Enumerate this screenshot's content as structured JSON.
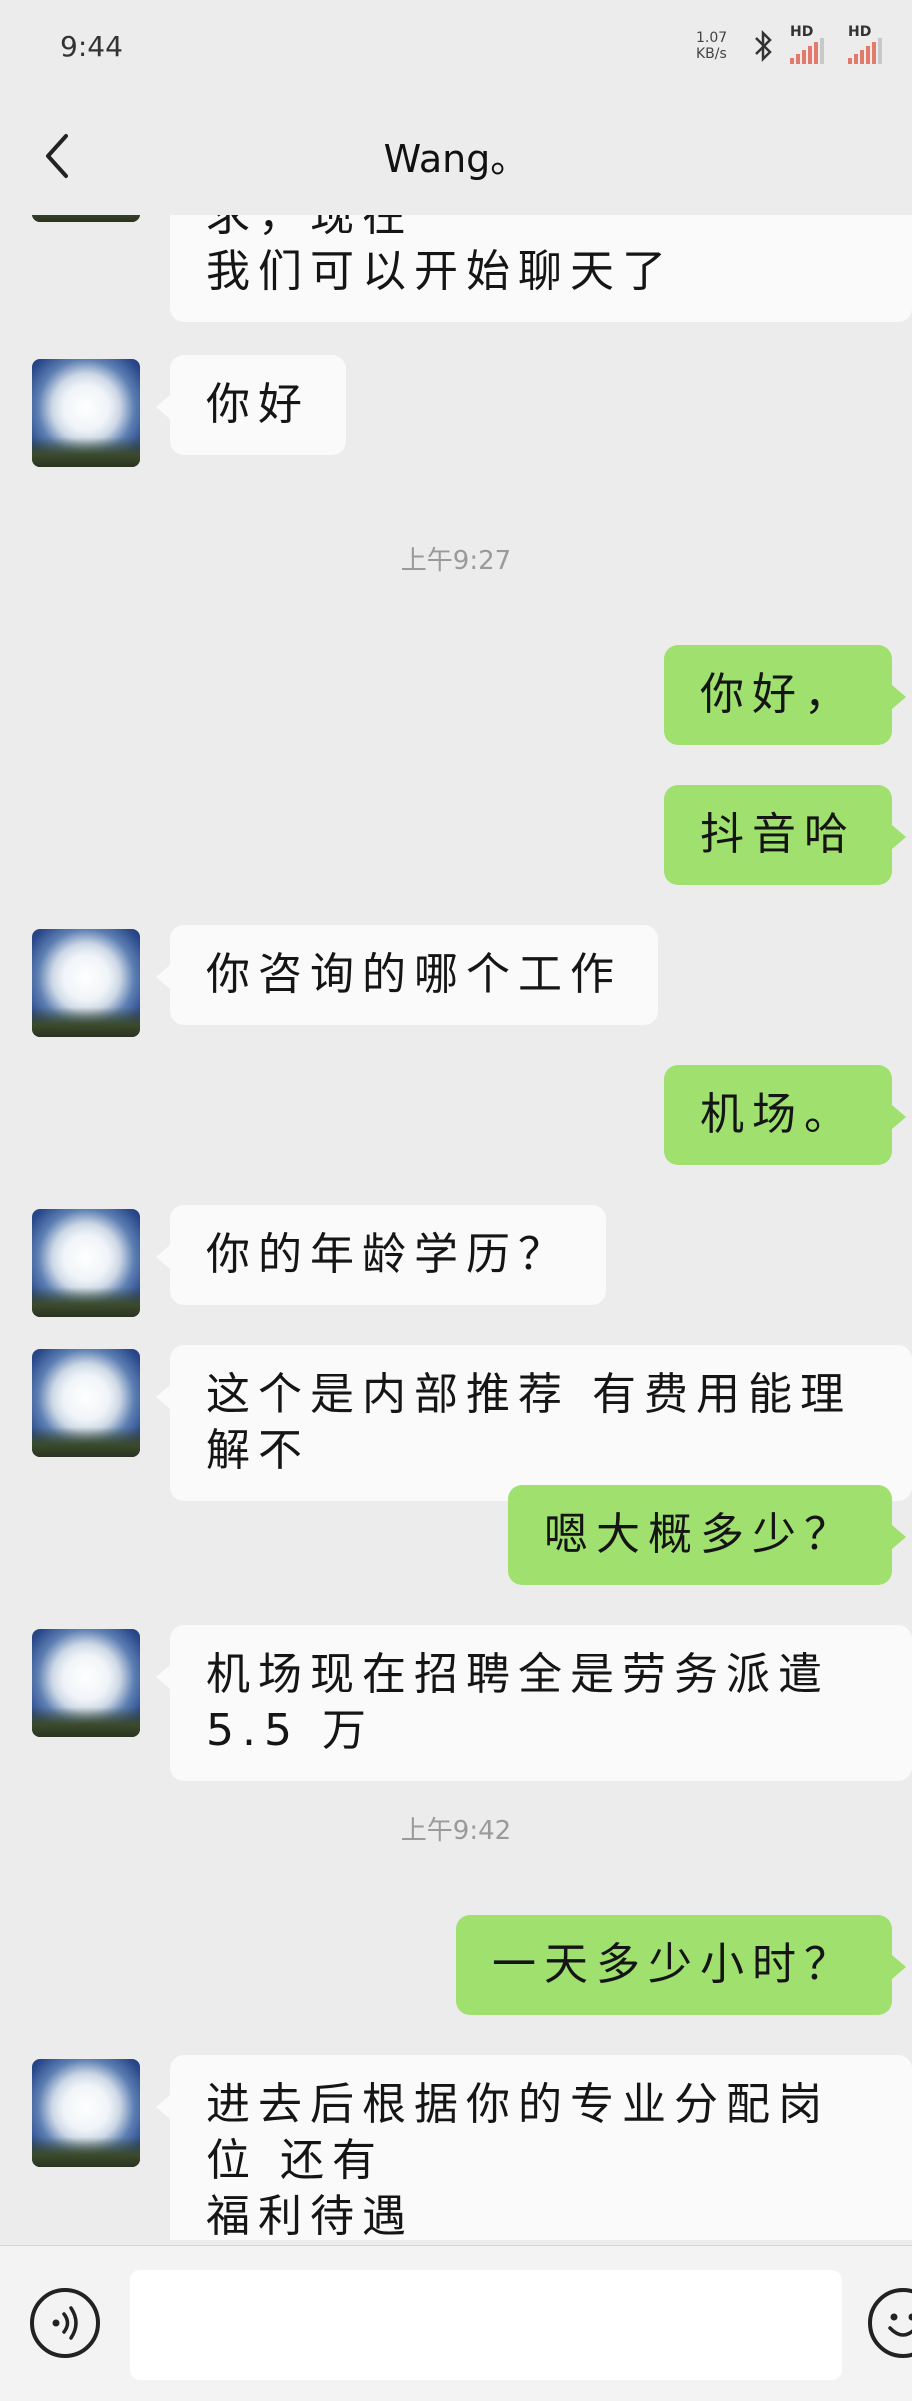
{
  "status_bar": {
    "time": "9:44",
    "net_speed_value": "1.07",
    "net_speed_unit": "KB/s",
    "sim1_label": "HD",
    "sim2_label": "HD",
    "icons": [
      "bluetooth-icon",
      "signal-icon",
      "signal-icon"
    ]
  },
  "header": {
    "title": "Wang。",
    "back_icon": "chevron-left-icon"
  },
  "messages": [
    {
      "side": "left",
      "lines": [
        "我通过了你的朋友验证请求，现在",
        "我们可以开始聊天了"
      ]
    },
    {
      "side": "left",
      "lines": [
        "你好"
      ]
    },
    {
      "type": "time",
      "text": "上午9:27"
    },
    {
      "side": "right",
      "lines": [
        "你好，"
      ]
    },
    {
      "side": "right",
      "lines": [
        "抖音哈"
      ]
    },
    {
      "side": "left",
      "lines": [
        "你咨询的哪个工作"
      ]
    },
    {
      "side": "right",
      "lines": [
        "机场。"
      ]
    },
    {
      "side": "left",
      "lines": [
        "你的年龄学历？"
      ]
    },
    {
      "side": "left",
      "lines": [
        "这个是内部推荐 有费用能理解不"
      ]
    },
    {
      "side": "right",
      "lines": [
        "嗯大概多少？"
      ]
    },
    {
      "side": "left",
      "lines": [
        "机场现在招聘全是劳务派遣 5.5 万"
      ]
    },
    {
      "type": "time",
      "text": "上午9:42"
    },
    {
      "side": "right",
      "lines": [
        "一天多少小时？"
      ]
    },
    {
      "side": "left",
      "lines": [
        "进去后根据你的专业分配岗位 还有",
        "福利待遇"
      ]
    }
  ],
  "input_bar": {
    "voice_icon": "voice-icon",
    "emoji_icon": "emoji-icon",
    "placeholder": ""
  },
  "colors": {
    "background": "#ececec",
    "left_bubble": "#fafafa",
    "right_bubble": "#9fe06f"
  }
}
